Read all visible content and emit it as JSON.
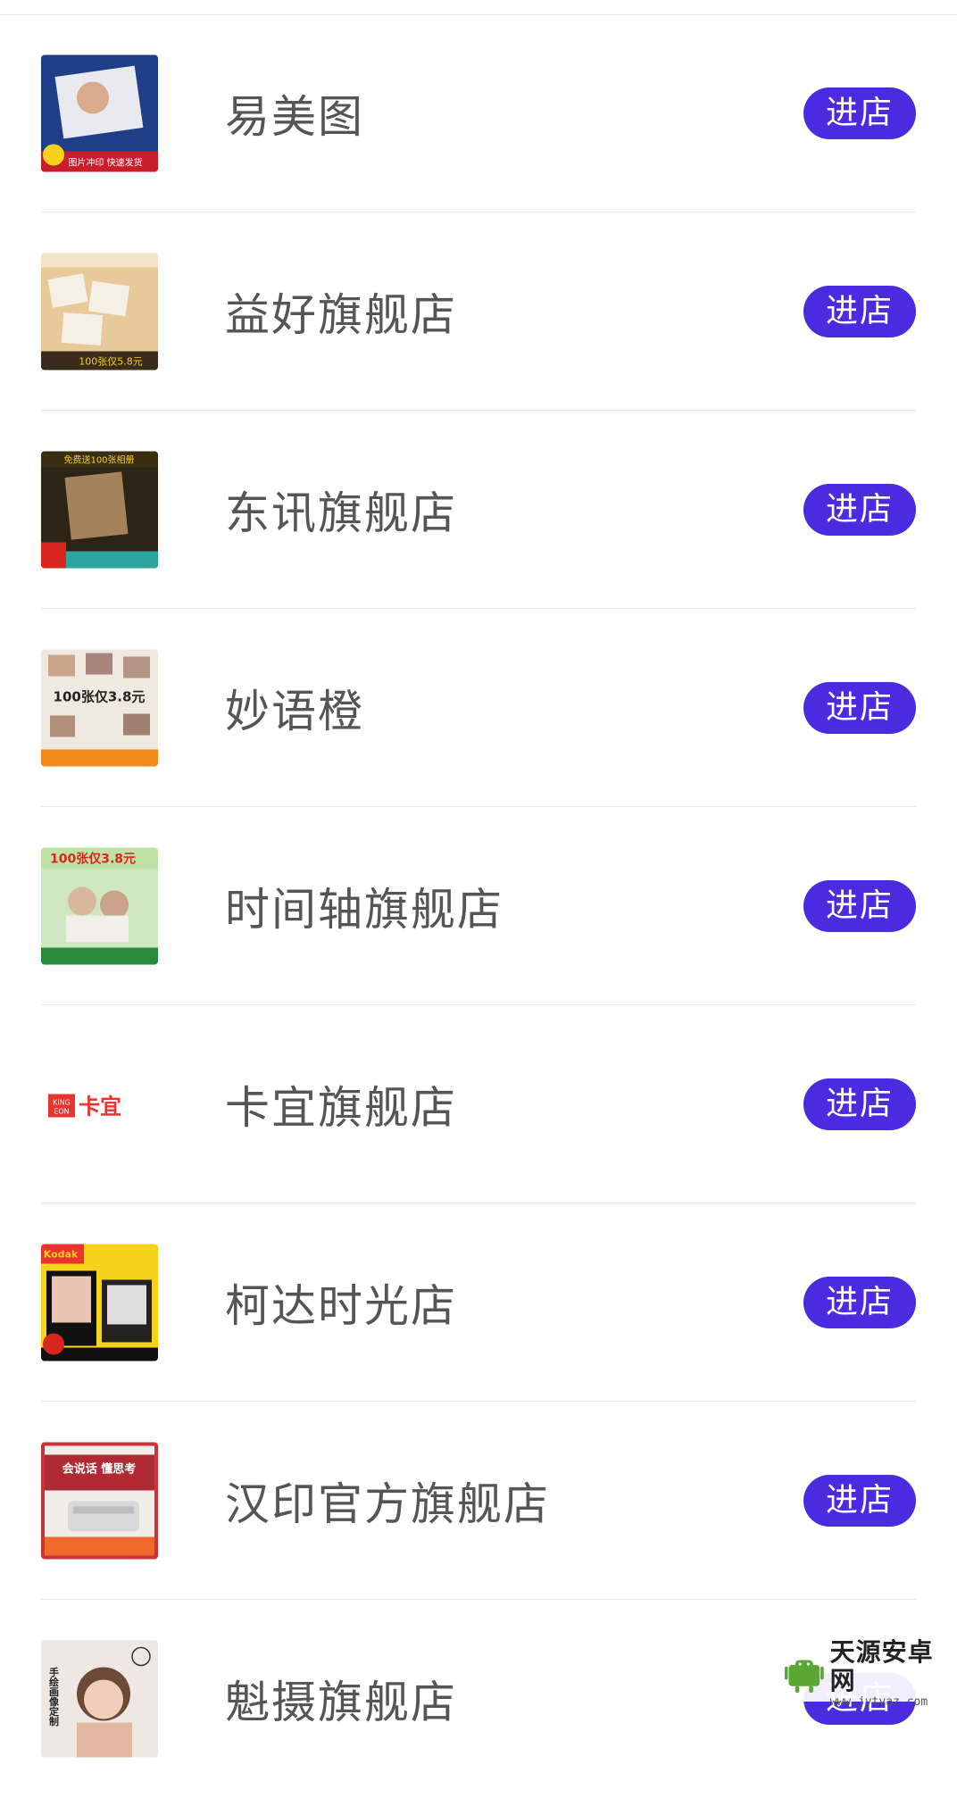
{
  "stores": [
    {
      "name": "易美图",
      "button": "进店",
      "thumb_text": "图片冲印 快速发货"
    },
    {
      "name": "益好旗舰店",
      "button": "进店",
      "thumb_text": "100张仅5.8元"
    },
    {
      "name": "东讯旗舰店",
      "button": "进店",
      "thumb_text": "免费送100张相册"
    },
    {
      "name": "妙语橙",
      "button": "进店",
      "thumb_text": "100张仅3.8元"
    },
    {
      "name": "时间轴旗舰店",
      "button": "进店",
      "thumb_text": "100张仅3.8元"
    },
    {
      "name": "卡宜旗舰店",
      "button": "进店",
      "thumb_text": "卡宜"
    },
    {
      "name": "柯达时光店",
      "button": "进店",
      "thumb_text": "Kodak"
    },
    {
      "name": "汉印官方旗舰店",
      "button": "进店",
      "thumb_text": "会说话 懂思考"
    },
    {
      "name": "魁摄旗舰店",
      "button": "进店",
      "thumb_text": "手绘画像定制"
    }
  ],
  "watermark": {
    "title": "天源安卓网",
    "url": "www.jytyaz.com"
  },
  "colors": {
    "accent": "#4a2be0",
    "store_name": "#555555"
  }
}
